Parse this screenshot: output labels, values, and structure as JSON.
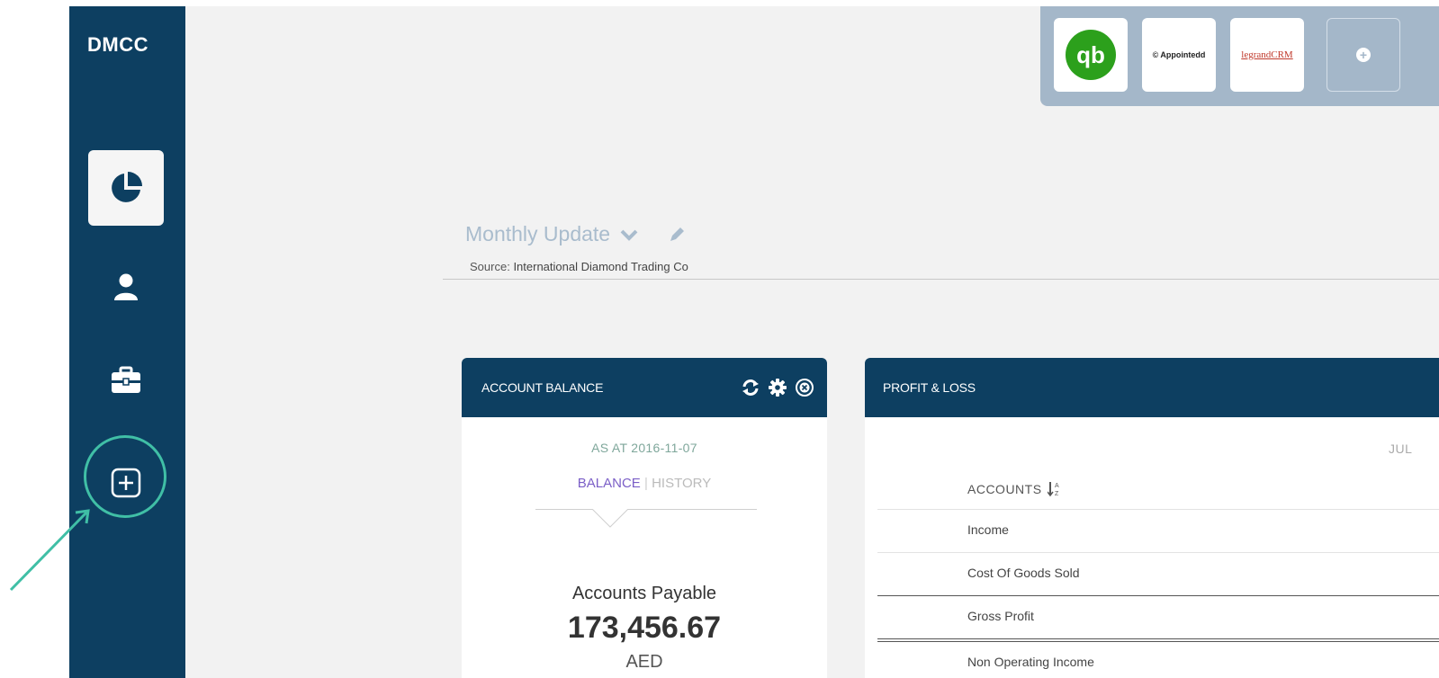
{
  "brand": "DMCC",
  "colors": {
    "sidebar": "#0d3f61",
    "accent_purple": "#7b5fc7",
    "annotation": "#40bfa6",
    "integration_bar": "#a4b7c9"
  },
  "sidebar": {
    "items": [
      {
        "icon": "pie-chart-icon",
        "active": true
      },
      {
        "icon": "user-icon",
        "active": false
      },
      {
        "icon": "briefcase-icon",
        "active": false
      },
      {
        "icon": "add-square-icon",
        "active": false
      }
    ]
  },
  "integrations": {
    "apps": [
      {
        "name": "quickbooks",
        "label": "qb"
      },
      {
        "name": "appointedd",
        "label": "© Appointedd"
      },
      {
        "name": "legrand",
        "label": "legrandCRM"
      }
    ],
    "add_label": "+"
  },
  "header": {
    "title": "Monthly Update",
    "source_label": "Source:",
    "source_value": "International Diamond Trading Co"
  },
  "account_balance": {
    "title": "ACCOUNT BALANCE",
    "as_at": "AS AT 2016-11-07",
    "tab_balance": "BALANCE",
    "tab_separator": "|",
    "tab_history": "HISTORY",
    "account_label": "Accounts Payable",
    "value": "173,456.67",
    "currency": "AED"
  },
  "profit_loss": {
    "title": "PROFIT & LOSS",
    "period": "JUL",
    "column_header": "ACCOUNTS",
    "rows": [
      "Income",
      "Cost Of Goods Sold",
      "Gross Profit",
      "Non Operating Income"
    ]
  }
}
